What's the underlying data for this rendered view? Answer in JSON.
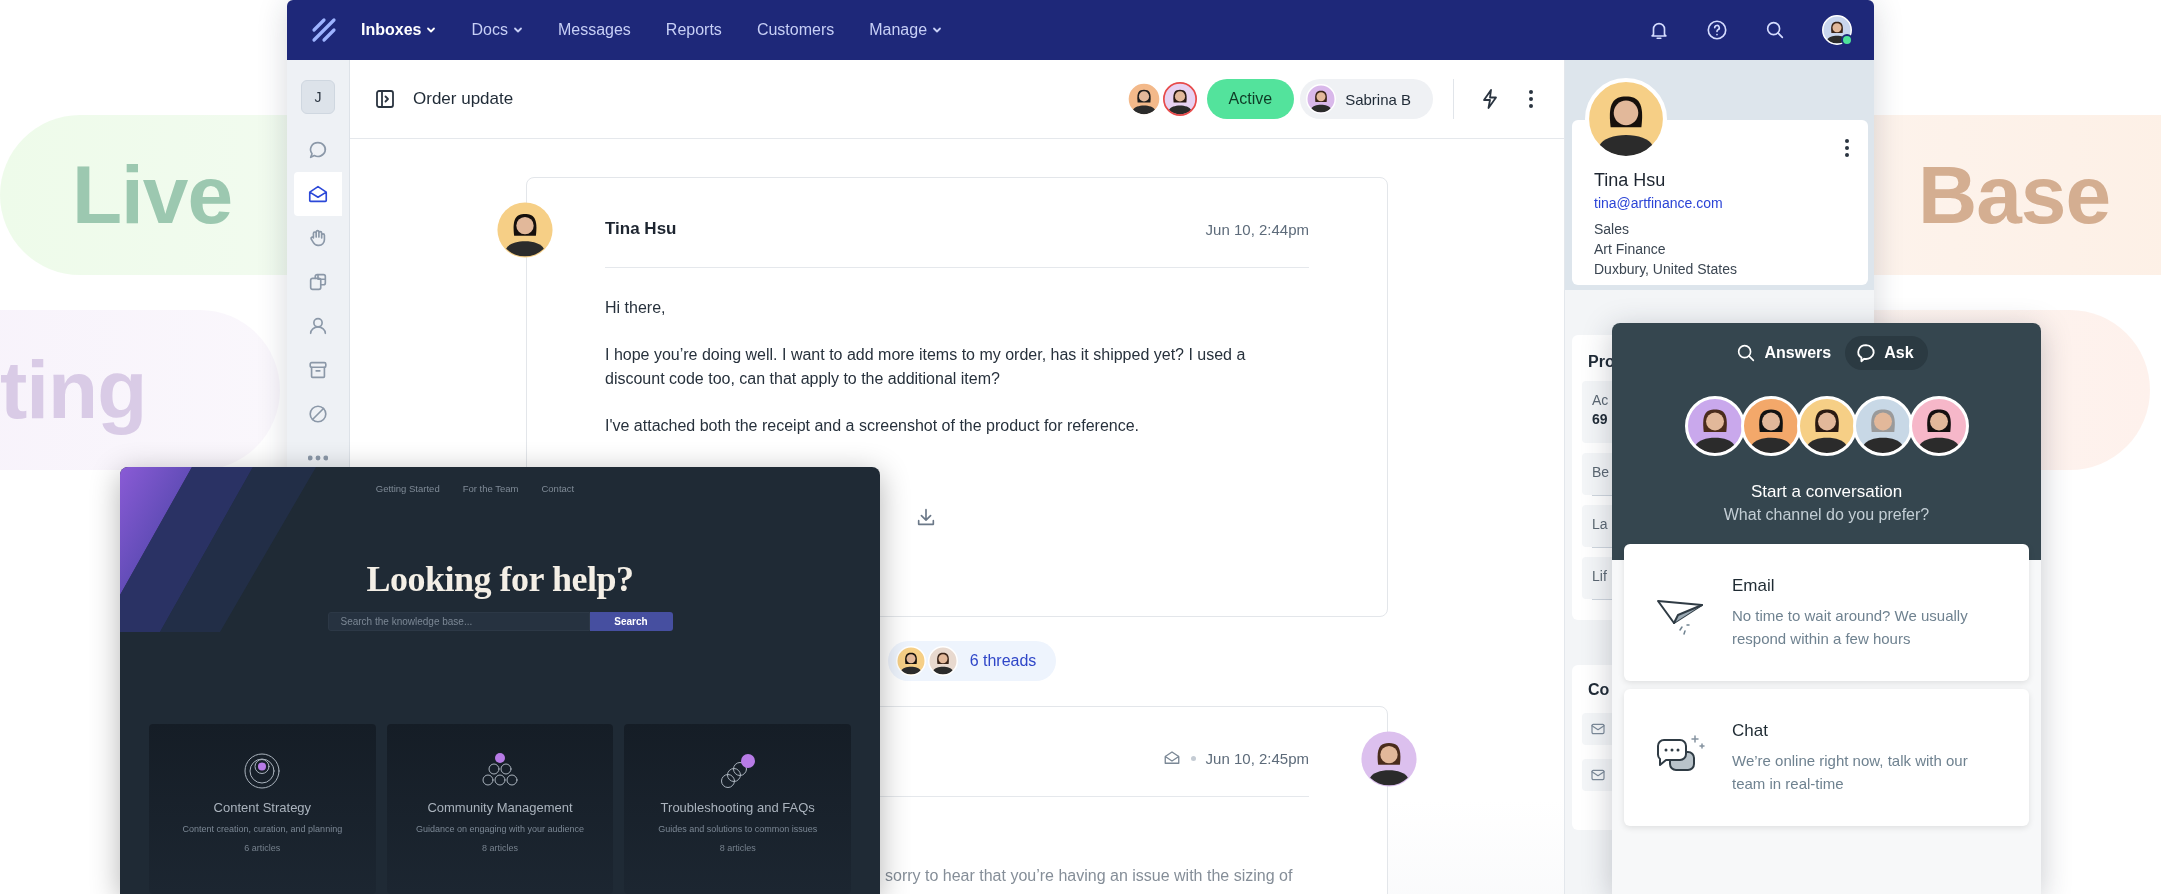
{
  "background_labels": [
    {
      "text": "Live",
      "color": "#9cc8b0"
    },
    {
      "text": "ting",
      "color": "#d9cbe6"
    },
    {
      "text": "Base",
      "color": "#d4ae91"
    }
  ],
  "app": {
    "nav": [
      {
        "label": "Inboxes",
        "dropdown": true,
        "selected": true
      },
      {
        "label": "Docs",
        "dropdown": true,
        "selected": false
      },
      {
        "label": "Messages",
        "dropdown": false,
        "selected": false
      },
      {
        "label": "Reports",
        "dropdown": false,
        "selected": false
      },
      {
        "label": "Customers",
        "dropdown": false,
        "selected": false
      },
      {
        "label": "Manage",
        "dropdown": true,
        "selected": false
      }
    ],
    "rail": {
      "initial": "J",
      "items": [
        {
          "selected": false
        },
        {
          "selected": true
        },
        {
          "selected": false
        },
        {
          "selected": false
        },
        {
          "selected": false
        },
        {
          "selected": false
        },
        {
          "selected": false
        },
        {
          "selected": false
        }
      ]
    },
    "conversation": {
      "title": "Order update",
      "status": "Active",
      "assignee": "Sabrina B"
    },
    "messages": [
      {
        "kind": "customer",
        "author": "Tina Hsu",
        "time": "Jun 10, 2:44pm",
        "paragraphs": [
          "Hi there,",
          "I hope you’re doing well. I want to add more items to my order, has it shipped yet? I used a discount code too, can that apply to the additional item?",
          "I've attached both the receipt and a screenshot of the product for reference."
        ]
      },
      {
        "kind": "agent",
        "time": "Jun 10, 2:45pm",
        "paragraphs": [
          "sorry to hear that you’re having an issue with the sizing of"
        ]
      }
    ],
    "threads": "6 threads",
    "customer": {
      "name": "Tina Hsu",
      "email": "tina@artfinance.com",
      "details": [
        "Sales",
        "Art Finance",
        "Duxbury, United States"
      ]
    },
    "properties": {
      "title": "Pro",
      "rows": [
        {
          "label": "Ac",
          "value": "69"
        },
        {
          "label": "Be"
        },
        {
          "label": "La"
        },
        {
          "label": "Lif"
        }
      ]
    },
    "contacts": {
      "title": "Co"
    }
  },
  "knowledge_base": {
    "links": [
      "Getting Started",
      "For the Team",
      "Contact"
    ],
    "title": "Looking for help?",
    "search": {
      "placeholder": "Search the knowledge base...",
      "button": "Search"
    },
    "categories": [
      {
        "title": "Content Strategy",
        "description": "Content creation, curation, and planning",
        "count": "6 articles"
      },
      {
        "title": "Community Management",
        "description": "Guidance on engaging with your audience",
        "count": "8 articles"
      },
      {
        "title": "Troubleshooting and FAQs",
        "description": "Guides and solutions to common issues",
        "count": "8 articles"
      }
    ]
  },
  "widget": {
    "tabs": [
      {
        "label": "Answers",
        "selected": false
      },
      {
        "label": "Ask",
        "selected": true
      }
    ],
    "title": "Start a conversation",
    "subtitle": "What channel do you prefer?",
    "channels": [
      {
        "kind": "email",
        "title": "Email",
        "description": "No time to wait around? We usually respond within a few hours"
      },
      {
        "kind": "chat",
        "title": "Chat",
        "description": "We’re online right now, talk with our team in real-time"
      }
    ]
  }
}
